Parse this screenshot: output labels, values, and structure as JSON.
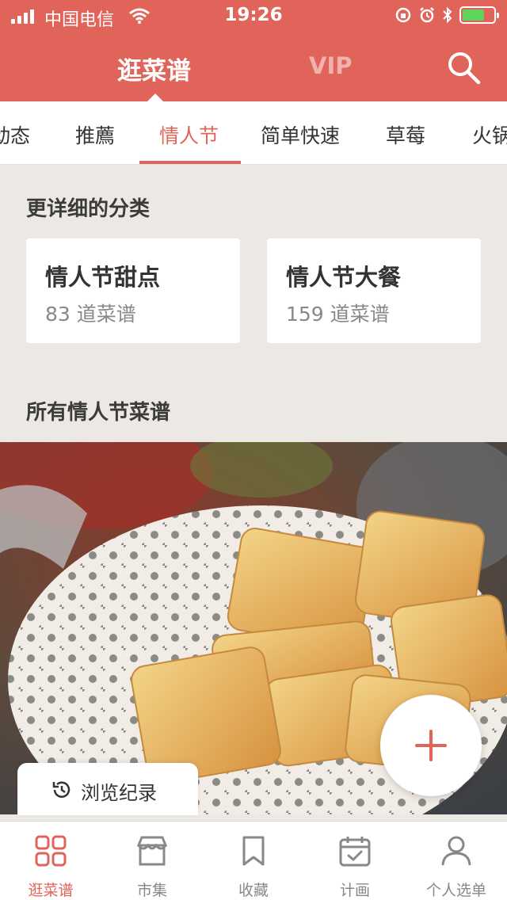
{
  "status_bar": {
    "carrier": "中国电信",
    "time": "19:26"
  },
  "nav": {
    "title": "逛菜谱",
    "vip": "VIP"
  },
  "tabs": [
    {
      "label": "动态"
    },
    {
      "label": "推薦"
    },
    {
      "label": "情人节",
      "active": true
    },
    {
      "label": "简单快速"
    },
    {
      "label": "草莓"
    },
    {
      "label": "火锅"
    }
  ],
  "subcategories": {
    "title": "更详细的分类",
    "items": [
      {
        "title": "情人节甜点",
        "count": "83 道菜谱"
      },
      {
        "title": "情人节大餐",
        "count": "159 道菜谱"
      }
    ]
  },
  "all_recipes": {
    "title": "所有情人节菜谱"
  },
  "history_button": {
    "label": "浏览纪录"
  },
  "bottom_nav": [
    {
      "label": "逛菜谱",
      "icon": "grid-icon",
      "active": true
    },
    {
      "label": "市集",
      "icon": "store-icon"
    },
    {
      "label": "收藏",
      "icon": "bookmark-icon"
    },
    {
      "label": "计画",
      "icon": "calendar-check-icon"
    },
    {
      "label": "个人选单",
      "icon": "person-icon"
    }
  ],
  "colors": {
    "accent": "#e0645a",
    "background": "#ece8e3"
  }
}
